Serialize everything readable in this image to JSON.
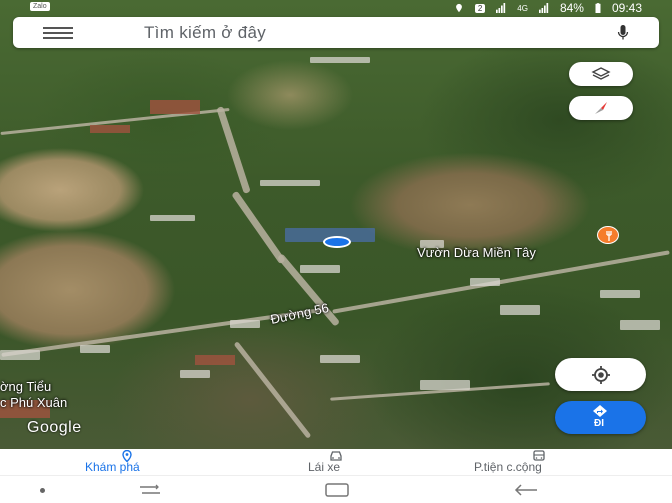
{
  "status_bar": {
    "app_badge": "Zalo",
    "sim_badge": "2",
    "network": "4G",
    "battery": "84%",
    "time": "09:43"
  },
  "search": {
    "placeholder": "Tìm kiếm ở đây"
  },
  "map": {
    "places": {
      "poi_name": "Vườn Dừa Miền Tây",
      "road_name": "Đường 56",
      "partial_label_line1": "ờng Tiểu",
      "partial_label_line2": "c Phú Xuân"
    },
    "attribution": "Google"
  },
  "buttons": {
    "go_label": "ĐI"
  },
  "bottom_nav": {
    "items": [
      {
        "label": "Khám phá",
        "icon": "pin-icon",
        "active": true
      },
      {
        "label": "Lái xe",
        "icon": "car-icon",
        "active": false
      },
      {
        "label": "P.tiện c.cộng",
        "icon": "bus-icon",
        "active": false
      }
    ]
  },
  "colors": {
    "accent": "#1a73e8",
    "active_nav": "#1a73e8",
    "inactive_nav": "#5f6368",
    "poi": "#f57c2b"
  }
}
